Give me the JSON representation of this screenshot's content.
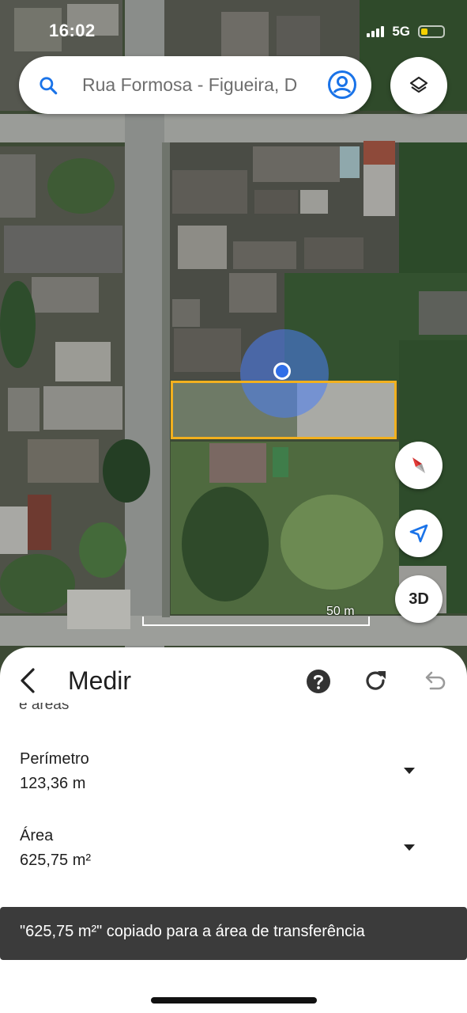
{
  "status_bar": {
    "time": "16:02",
    "network": "5G"
  },
  "search": {
    "query": "Rua Formosa - Figueira, D"
  },
  "map": {
    "scale_label": "50 m",
    "view_3d_label": "3D",
    "measure_color": "#f2b01e",
    "location_color": "#2f6ee8"
  },
  "sheet": {
    "title": "Medir",
    "cut_text": "e áreas",
    "perimeter_label": "Perímetro",
    "perimeter_value": "123,36 m",
    "area_label": "Área",
    "area_value": "625,75 m²"
  },
  "toast": {
    "message": "\"625,75 m²\" copiado para a área de transferência"
  },
  "icons": [
    "search-icon",
    "account-icon",
    "layers-icon",
    "compass-icon",
    "navigation-arrow-icon",
    "back-arrow-icon",
    "help-icon",
    "redo-icon",
    "undo-icon",
    "chevron-down-icon"
  ]
}
